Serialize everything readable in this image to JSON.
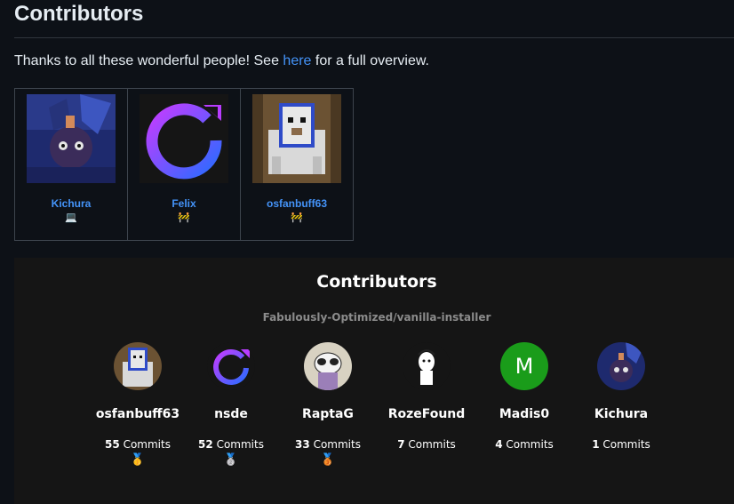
{
  "heading": "Contributors",
  "intro": {
    "before": "Thanks to all these wonderful people! See ",
    "link": "here",
    "after": " for a full overview."
  },
  "all_contributors": [
    {
      "name": "Kichura",
      "emoji": "💻"
    },
    {
      "name": "Felix",
      "emoji": "🚧"
    },
    {
      "name": "osfanbuff63",
      "emoji": "🚧"
    }
  ],
  "panel": {
    "title": "Contributors",
    "repo": "Fabulously-Optimized/vanilla-installer",
    "commits_word": "Commits",
    "contributors": [
      {
        "name": "osfanbuff63",
        "commits": "55",
        "medal": "🥇"
      },
      {
        "name": "nsde",
        "commits": "52",
        "medal": "🥈"
      },
      {
        "name": "RaptaG",
        "commits": "33",
        "medal": "🥉"
      },
      {
        "name": "RozeFound",
        "commits": "7",
        "medal": ""
      },
      {
        "name": "Madis0",
        "commits": "4",
        "medal": "",
        "initial": "M"
      },
      {
        "name": "Kichura",
        "commits": "1",
        "medal": ""
      }
    ]
  },
  "colors": {
    "link": "#4493f8",
    "madis_avatar": "#1a9c1a"
  }
}
